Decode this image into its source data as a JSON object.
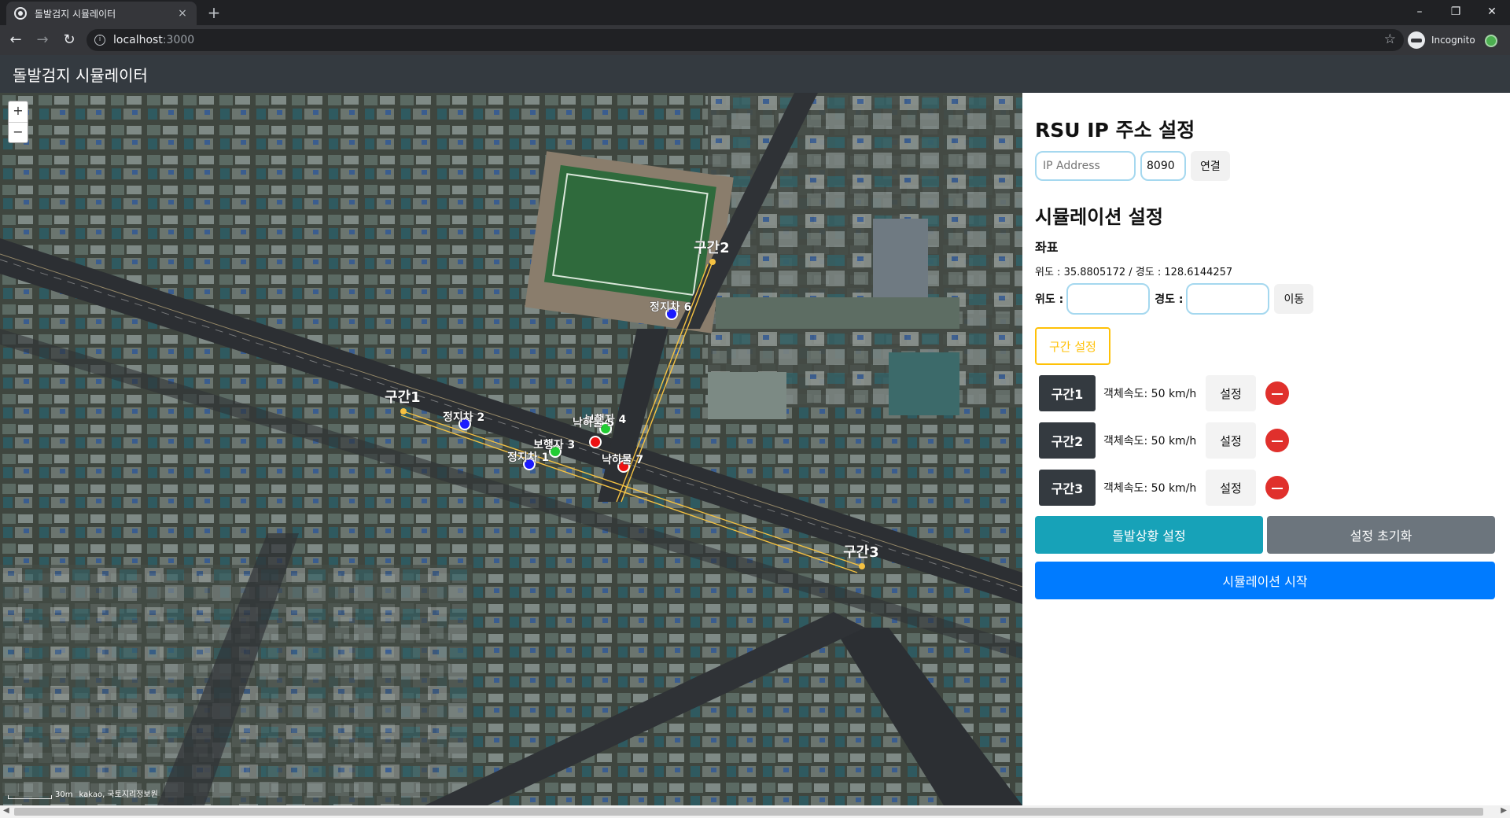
{
  "browser": {
    "tab_title": "돌발검지 시뮬레이터",
    "tab_close": "×",
    "new_tab": "+",
    "url_host": "localhost",
    "url_port": ":3000",
    "incognito_label": "Incognito",
    "window_controls": [
      "–",
      "❐",
      "✕"
    ]
  },
  "app": {
    "brand": "돌발검지 시뮬레이터"
  },
  "map": {
    "zoom_in": "+",
    "zoom_out": "−",
    "scale_label": "30m",
    "copyright": "kakao, 국토지리정보원",
    "marker_colors": {
      "vehicle": "#1a1aff",
      "pedestrian": "#22cc33",
      "falling": "#ee1111",
      "segment": "#f5c242"
    },
    "segments": [
      "구간1",
      "구간2",
      "구간3"
    ],
    "markers": [
      {
        "label": "정지차 1",
        "kind": "vehicle"
      },
      {
        "label": "정지차 2",
        "kind": "vehicle"
      },
      {
        "label": "보행자 3",
        "kind": "pedestrian"
      },
      {
        "label": "보행자 4",
        "kind": "falling"
      },
      {
        "label": "낙하물 5",
        "kind": "pedestrian"
      },
      {
        "label": "정지차 6",
        "kind": "vehicle"
      },
      {
        "label": "낙하물 7",
        "kind": "falling"
      }
    ]
  },
  "rsu": {
    "title": "RSU IP 주소 설정",
    "ip_placeholder": "IP Address",
    "port_value": "8090",
    "connect_label": "연결"
  },
  "sim": {
    "title": "시뮬레이션 설정",
    "coord_title": "좌표",
    "coord_readout": "위도 : 35.8805172 / 경도 : 128.6144257",
    "lat_label": "위도 :",
    "lng_label": "경도 :",
    "move_label": "이동",
    "segment_button": "구간 설정",
    "segments": [
      {
        "name": "구간1",
        "speed": "객체속도: 50 km/h",
        "set": "설정"
      },
      {
        "name": "구간2",
        "speed": "객체속도: 50 km/h",
        "set": "설정"
      },
      {
        "name": "구간3",
        "speed": "객체속도: 50 km/h",
        "set": "설정"
      }
    ],
    "incident_button": "돌발상황 설정",
    "reset_button": "설정 초기화",
    "start_button": "시뮬레이션 시작"
  }
}
